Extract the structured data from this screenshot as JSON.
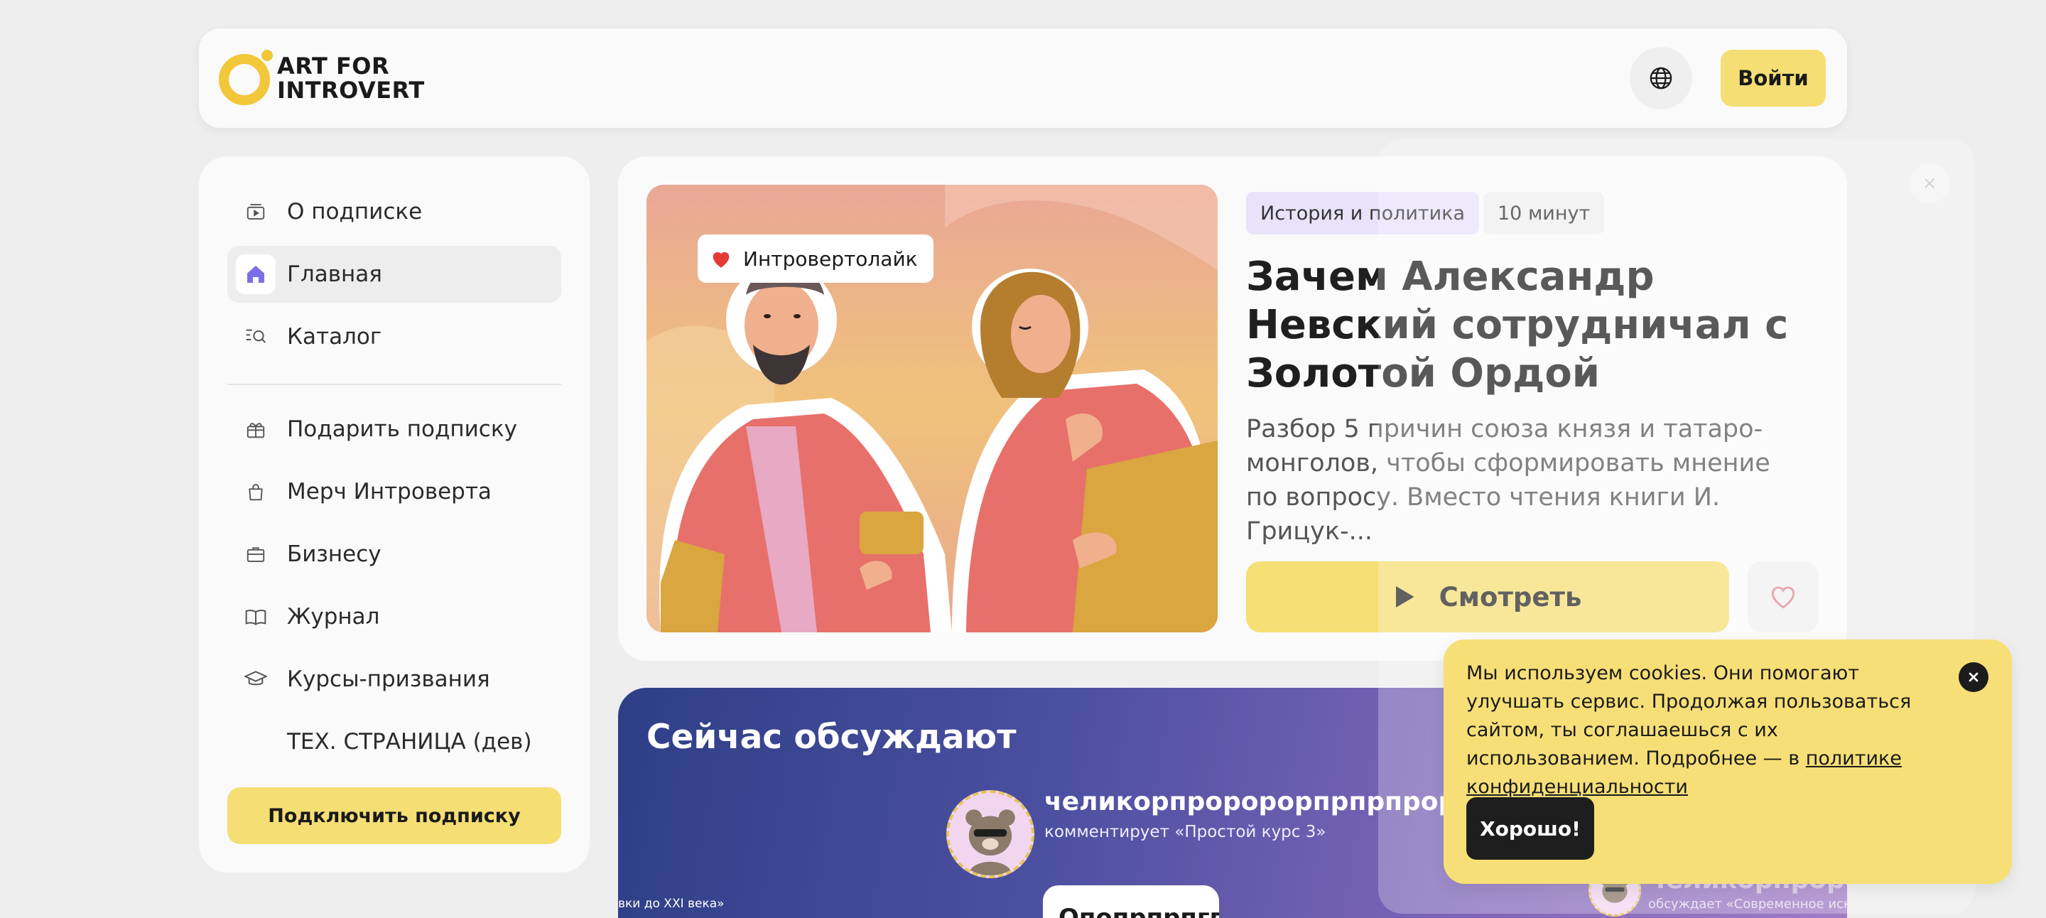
{
  "header": {
    "logo_line1": "ART FOR",
    "logo_line2": "INTROVERT",
    "login_label": "Войти"
  },
  "sidebar": {
    "items": [
      {
        "label": "О подписке",
        "icon": "video-icon"
      },
      {
        "label": "Главная",
        "icon": "home-icon",
        "active": true
      },
      {
        "label": "Каталог",
        "icon": "catalog-search-icon"
      },
      {
        "label": "Подарить подписку",
        "icon": "gift-icon"
      },
      {
        "label": "Мерч Интроверта",
        "icon": "bag-icon"
      },
      {
        "label": "Бизнесу",
        "icon": "briefcase-icon"
      },
      {
        "label": "Журнал",
        "icon": "book-icon"
      },
      {
        "label": "Курсы-призвания",
        "icon": "graduation-cap-icon"
      },
      {
        "label": "ТЕХ. СТРАНИЦА (дев)",
        "icon": ""
      }
    ],
    "subscribe_label": "Подключить подписку"
  },
  "feature": {
    "badge_label": "Интровертолайк",
    "category": "История и политика",
    "duration": "10 минут",
    "title": "Зачем Александр Невский сотрудничал с Золотой Ордой",
    "description": "Разбор 5 причин союза князя и татаро-монголов, чтобы сформировать мнение по вопросу. Вместо чтения книги И. Грицук-...",
    "watch_label": "Смотреть"
  },
  "discussion": {
    "title": "Сейчас обсуждают",
    "commenter_name": "челикорпроророрпрпрпроророр",
    "commenter_action": "комментирует «Простой курс 3»",
    "comment_preview": "Опопрпрпгпгп",
    "left_edge_text": "вки до XXI века»",
    "right_name": "челикорпророр",
    "right_action": "обсуждает «Современное искусство"
  },
  "cookie": {
    "text": "Мы используем cookies. Они помогают улучшать сервис. Продолжая пользоваться сайтом, ты соглашаешься с их использованием. Подробнее — в ",
    "link_text": "политике конфиденциальности",
    "ok_label": "Хорошо!"
  },
  "colors": {
    "accent_yellow": "#f5de73",
    "heart_red": "#e53935",
    "tag_lilac": "#e8e3fb",
    "home_icon_purple": "#7b6ee6"
  }
}
